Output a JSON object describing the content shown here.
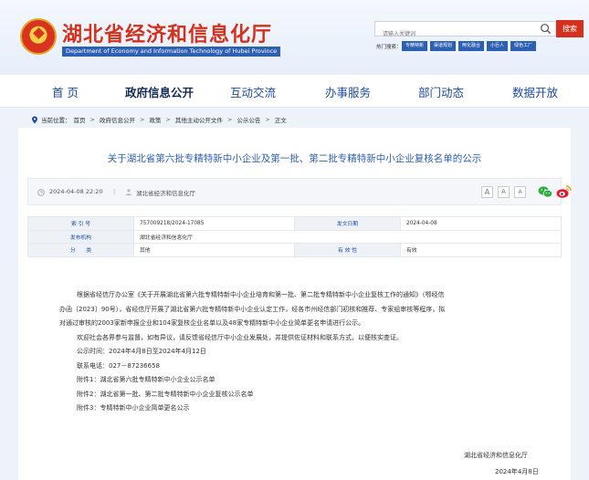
{
  "header": {
    "title": "湖北省经济和信息化厅",
    "subtitle": "Department of Economy and Information Technology of Hubei Province",
    "search_placeholder": "请输入关键词",
    "search_button": "搜索",
    "hot_label": "热门搜索：",
    "hot_tags": [
      "专精特新",
      "渠道规划",
      "两化融合",
      "小巨人",
      "绿色工厂"
    ]
  },
  "nav": {
    "items": [
      "首 页",
      "政府信息公开",
      "互动交流",
      "办事服务",
      "部门动态",
      "数据开放"
    ],
    "active_index": 1
  },
  "breadcrumb": {
    "prefix": "当前位置：",
    "items": [
      "首页",
      "政府信息公开",
      "政策",
      "其他主动公开文件",
      "公示公告",
      "正文"
    ]
  },
  "document": {
    "title": "关于湖北省第六批专精特新中小企业及第一批、第二批专精特新中小企业复核名单的公示",
    "date": "2024-04-08 22:20",
    "source": "湖北省经济和信息化厅",
    "font_sizes": [
      "A",
      "A",
      "A"
    ],
    "info": [
      {
        "k1": "索 引 号",
        "v1": "757009218/2024-17085",
        "k2": "发文日期",
        "v2": "2024-04-08"
      },
      {
        "k1": "发布机构",
        "v1": "湖北省经济和信息化厅",
        "k2": "",
        "v2": ""
      },
      {
        "k1": "分　　类",
        "v1": "其他",
        "k2": "有 效 性",
        "v2": "有效"
      }
    ],
    "para1": [
      "根据省经信厅办公室《关于开展湖北省第六批专精特新中小企业培育和第一批、第二批专精特新中小企业复核工作的通知》（鄂经信",
      "办函〔2023〕90号），省经信厅开展了湖北省第六批专精特新中小企业认定工作，经各市州经信部门初核和推荐、专家组审核等程序，拟",
      "对通过审核的2003家新申报企业和104家复核企业名单以及48家专精特新中小企业简单更名申请进行公示。"
    ],
    "para2": "欢迎社会各界参与监督，如有异议，请反馈省经信厅中小企业发展处，并提供佐证材料和联系方式，以便核实查证。",
    "period": "公示时间：2024年4月8日至2024年4月12日",
    "phone": "联系电话：027－87236658",
    "attachments": [
      "附件1：湖北省第六批专精特新中小企业公示名单",
      "附件2：湖北省第一批、第二批专精特新中小企业复核公示名单",
      "附件3：专精特新中小企业简单更名公示"
    ],
    "sign_org": "湖北省经济和信息化厅",
    "sign_date": "2024年4月8日"
  },
  "colors": {
    "brand_red": "#d4301c",
    "brand_blue": "#2d5fb3",
    "nav_text": "#1d4aa0"
  }
}
